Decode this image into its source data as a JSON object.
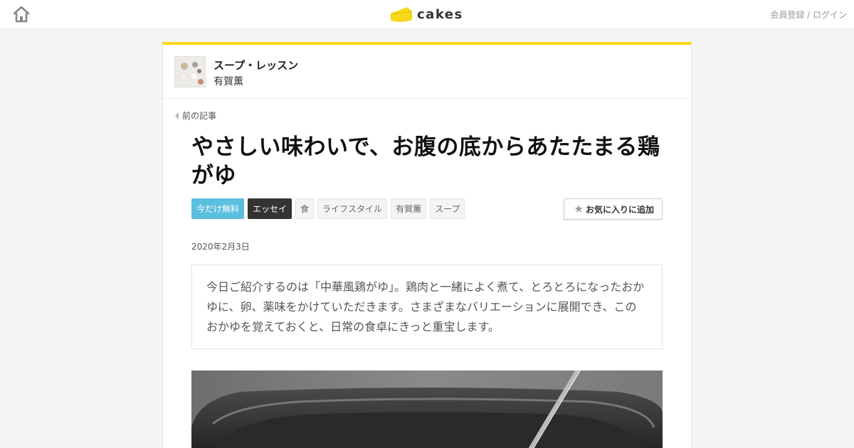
{
  "header": {
    "logo_text": "cakes",
    "auth_text": "会員登録 / ログイン",
    "brand_color": "#f7d81a"
  },
  "series": {
    "title": "スープ・レッスン",
    "author": "有賀薫"
  },
  "nav": {
    "prev_label": "前の記事"
  },
  "article": {
    "title": "やさしい味わいで、お腹の底からあたたまる鶏がゆ",
    "tags": [
      "今だけ無料",
      "エッセイ",
      "食",
      "ライフスタイル",
      "有賀薫",
      "スープ"
    ],
    "favorite_label": "お気に入りに追加",
    "date": "2020年2月3日",
    "lead": "今日ご紹介するのは「中華風鶏がゆ」。鶏肉と一緒によく煮て、とろとろになったおかゆに、卵、薬味をかけていただきます。さまざまなバリエーションに展開でき、このおかゆを覚えておくと、日常の食卓にきっと重宝します。"
  },
  "icons": {
    "home": "home-icon",
    "logo": "cheese-icon",
    "prev": "triangle-left-icon",
    "favorite": "star-icon"
  },
  "colors": {
    "free_tag": "#5bbfe0",
    "essay_tag": "#333333"
  }
}
